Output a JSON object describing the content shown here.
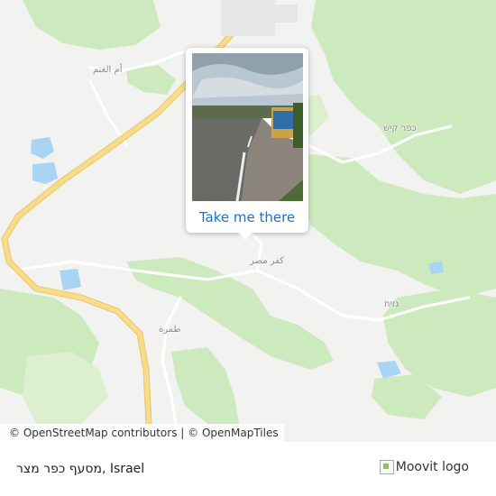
{
  "map": {
    "places": [
      {
        "id": "umm-al-ghanam",
        "name": "أم الغنم"
      },
      {
        "id": "kfar-kish",
        "name": "כפר קיש"
      },
      {
        "id": "kfar-misr",
        "name": "كفر مصر"
      },
      {
        "id": "gazit",
        "name": "גזית"
      },
      {
        "id": "tamra",
        "name": "طمرة"
      }
    ],
    "colors": {
      "background": "#f2f2f0",
      "forest": "#cdeabe",
      "forest_light": "#dcf0cf",
      "water": "#a9d4f2",
      "major_road": "#f7dc8b",
      "minor_road": "#ffffff"
    },
    "attribution": {
      "osm": "© OpenStreetMap contributors",
      "separator": "|",
      "omt": "© OpenMapTiles"
    }
  },
  "popup": {
    "photo_description": "bus stop beside road",
    "action_label": "Take me there"
  },
  "footer": {
    "stop_name": "מסעף כפר מצר, Israel",
    "logo_alt": "Moovit logo"
  }
}
